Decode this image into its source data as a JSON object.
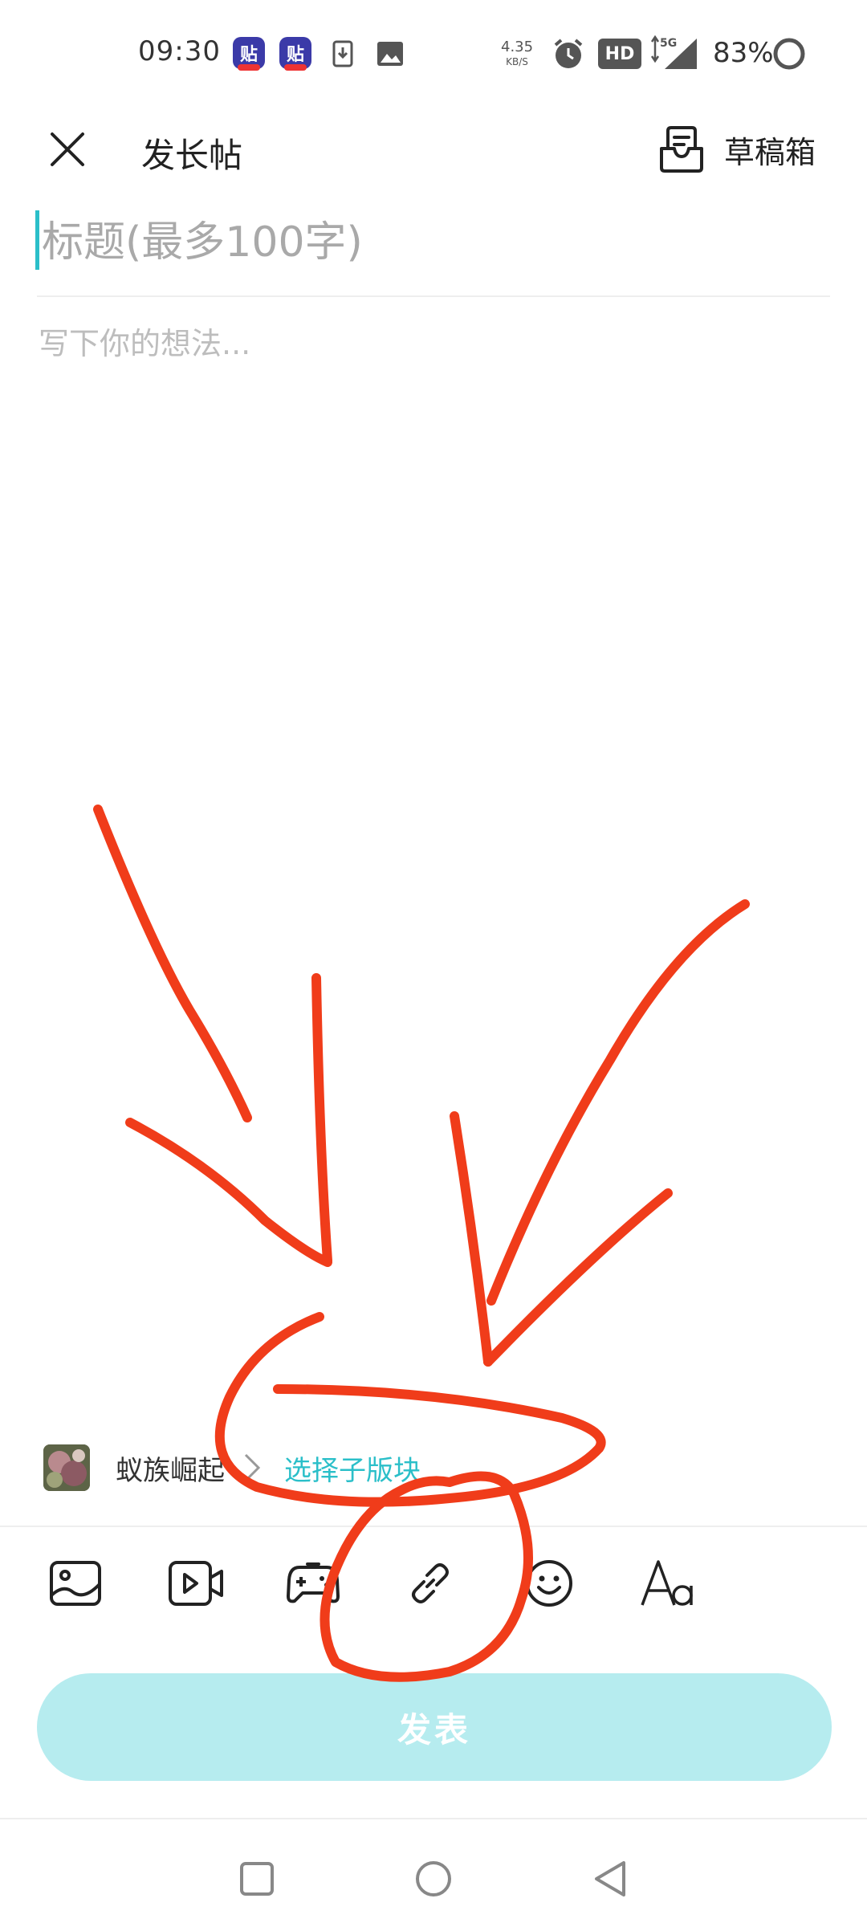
{
  "status_bar": {
    "time": "09:30",
    "app_badge_label": "贴",
    "net_speed_value": "4.35",
    "net_speed_unit": "KB/S",
    "network_type": "5G",
    "hd_label": "HD",
    "battery": "83%"
  },
  "header": {
    "title": "发长帖",
    "drafts_label": "草稿箱"
  },
  "editor": {
    "title_placeholder": "标题(最多100字)",
    "body_placeholder": "写下你的想法..."
  },
  "forum": {
    "name": "蚁族崛起",
    "sub_forum_label": "选择子版块"
  },
  "toolbar": {
    "items": [
      "image-icon",
      "video-icon",
      "game-controller-icon",
      "link-icon",
      "emoji-icon",
      "text-format-icon"
    ]
  },
  "publish": {
    "label": "发表"
  },
  "colors": {
    "accent": "#2bbfc9",
    "publish_bg": "#b6ecef",
    "annotation": "#f03c1a"
  }
}
